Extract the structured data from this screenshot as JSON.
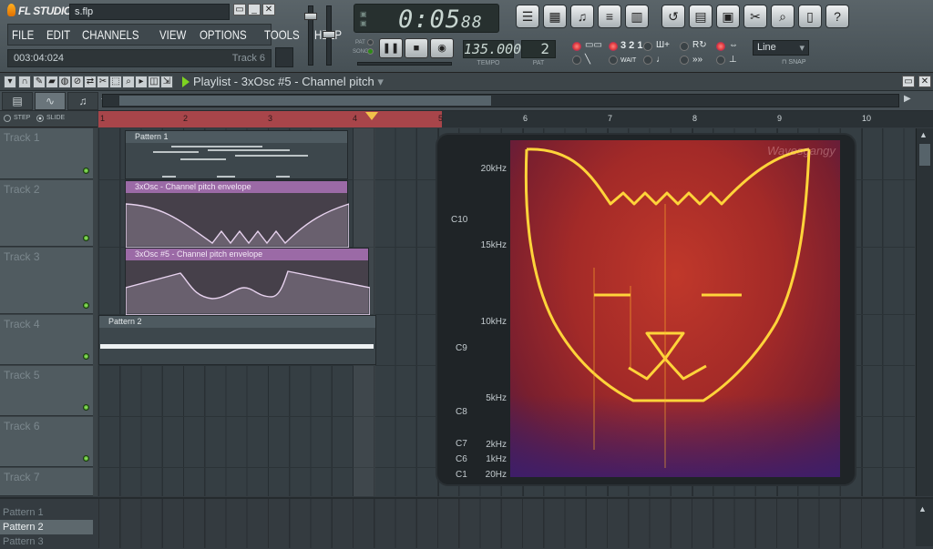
{
  "app": {
    "logo": "FL STUDIO",
    "file_name": "s.flp"
  },
  "menu": [
    "FILE",
    "EDIT",
    "CHANNELS",
    "VIEW",
    "OPTIONS",
    "TOOLS",
    "HELP"
  ],
  "hint_bar": {
    "position": "003:04:024",
    "item": "Track 6"
  },
  "time": {
    "main": "0:05",
    "sub": "88"
  },
  "transport": {
    "pat_label": "PAT",
    "song_label": "SONG"
  },
  "tempo": {
    "value": "135.000",
    "label": "TEMPO"
  },
  "pattern": {
    "value": "2",
    "label": "PAT"
  },
  "toolbar_icons": [
    "playlist-icon",
    "step-sequencer-icon",
    "piano-roll-icon",
    "browser-icon",
    "mixer-icon",
    "undo-icon",
    "save-icon",
    "save-as-icon",
    "cut-icon",
    "help-search-icon",
    "notes-icon",
    "question-icon"
  ],
  "record_options": {
    "count_in": "3 2 1",
    "wait": "WAIT"
  },
  "snap": {
    "value": "Line",
    "label": "SNAP"
  },
  "playlist": {
    "title": "Playlist - 3xOsc #5 - Channel pitch"
  },
  "view_modes": {
    "step": "STEP",
    "slide": "SLIDE"
  },
  "ruler": [
    "1",
    "2",
    "3",
    "4",
    "5",
    "6",
    "7",
    "8",
    "9",
    "10"
  ],
  "tracks": [
    "Track 1",
    "Track 2",
    "Track 3",
    "Track 4",
    "Track 5",
    "Track 6",
    "Track 7"
  ],
  "clips": {
    "pattern1": "Pattern 1",
    "env1": "3xOsc - Channel pitch envelope",
    "env2": "3xOsc #5 - Channel pitch envelope",
    "pattern2": "Pattern 2"
  },
  "spectrogram": {
    "watermark": "Wavesgangy",
    "freq_labels": [
      "20kHz",
      "15kHz",
      "10kHz",
      "5kHz",
      "2kHz",
      "1kHz",
      "20Hz"
    ],
    "note_labels": [
      "C10",
      "C9",
      "C8",
      "C7",
      "C6",
      "C1"
    ]
  },
  "pattern_list": [
    "Pattern 1",
    "Pattern 2",
    "Pattern 3"
  ],
  "colors": {
    "accent_green": "#7ed321",
    "loop_red": "#a8454a",
    "envelope_purple": "#9b6aa6",
    "spectro_line": "#ffd43a"
  }
}
